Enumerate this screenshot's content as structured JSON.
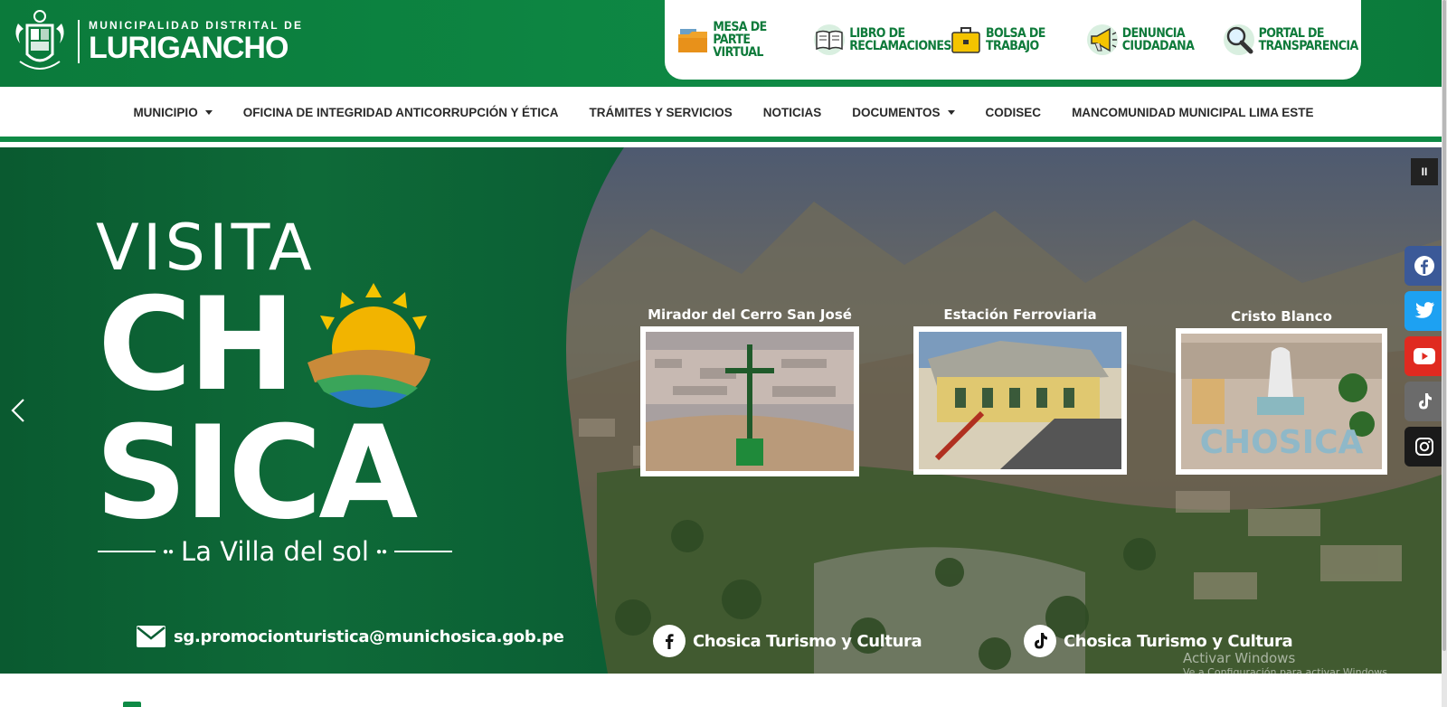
{
  "brand": {
    "small": "MUNICIPALIDAD DISTRITAL DE",
    "big": "LURIGANCHO"
  },
  "quick_links": [
    {
      "label": "MESA DE PARTE VIRTUAL",
      "icon": "folder-icon"
    },
    {
      "label": "LIBRO DE RECLAMACIONES",
      "icon": "book-icon"
    },
    {
      "label": "BOLSA DE TRABAJO",
      "icon": "briefcase-icon"
    },
    {
      "label": "DENUNCIA CIUDADANA",
      "icon": "megaphone-icon"
    },
    {
      "label": "PORTAL DE TRANSPARENCIA",
      "icon": "magnifier-icon"
    }
  ],
  "nav": {
    "items": [
      "MUNICIPIO",
      "OFICINA DE INTEGRIDAD ANTICORRUPCIÓN Y ÉTICA",
      "TRÁMITES Y SERVICIOS",
      "NOTICIAS",
      "DOCUMENTOS",
      "CODISEC",
      "MANCOMUNIDAD MUNICIPAL LIMA ESTE"
    ]
  },
  "hero": {
    "visita": "VISITA",
    "cho": "CH",
    "sica": "SICA",
    "tagline": "La Villa del sol",
    "email": "sg.promocionturistica@munichosica.gob.pe",
    "facebook_label": "Chosica Turismo y Cultura",
    "tiktok_label": "Chosica Turismo y Cultura",
    "places": [
      "Mirador del Cerro San José",
      "Estación Ferroviaria",
      "Cristo Blanco"
    ],
    "photo_text": "CHOSICA",
    "pause_label": "II"
  },
  "watermark": {
    "title": "Activar Windows",
    "sub": "Ve a Configuración para activar Windows."
  },
  "colors": {
    "brand_green": "#0e8a45",
    "dark_green": "#0b5e34",
    "facebook": "#3b5998",
    "twitter": "#1da1f2",
    "youtube": "#e02a20",
    "tiktok": "#6b6b6b",
    "instagram": "#1a1a1a"
  }
}
